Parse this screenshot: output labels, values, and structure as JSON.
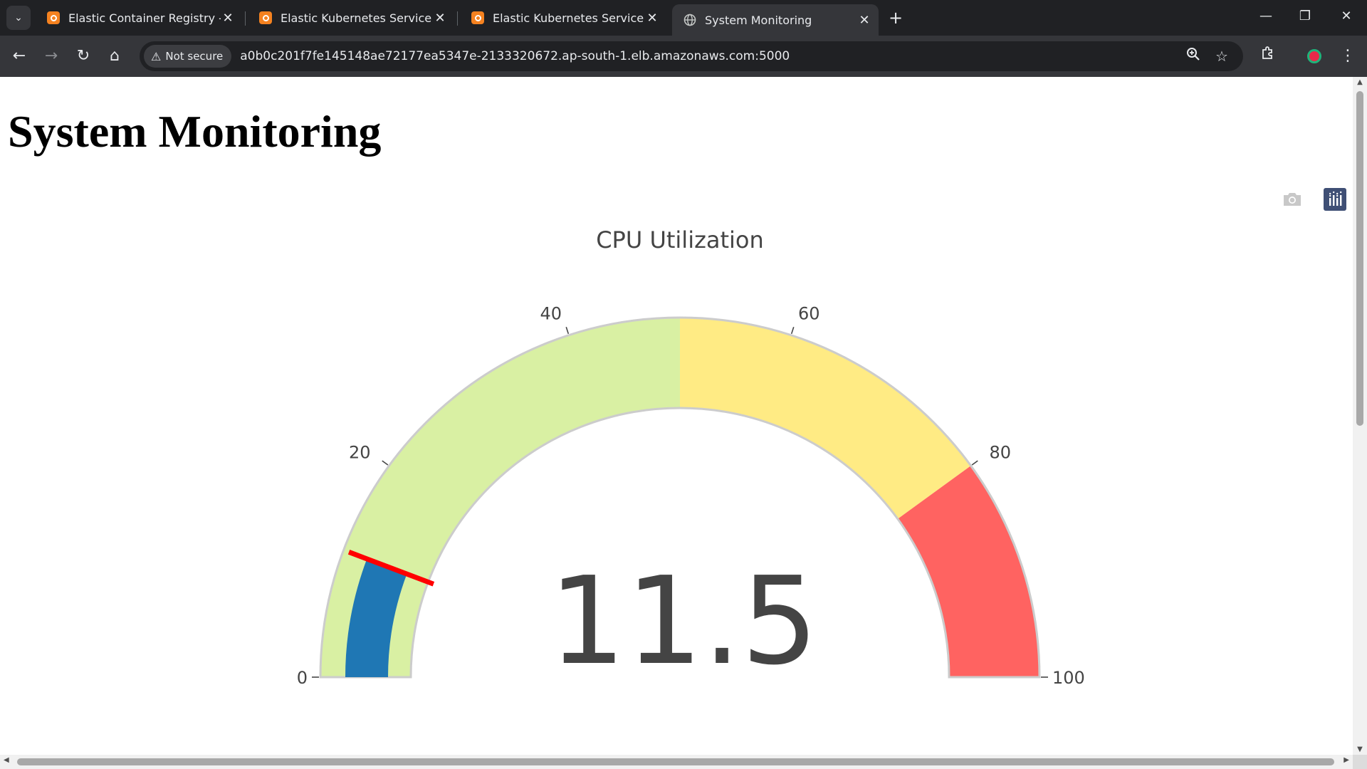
{
  "browser": {
    "tabs": [
      {
        "title": "Elastic Container Registry - Ima",
        "active": false,
        "icon": "aws-orange-icon"
      },
      {
        "title": "Elastic Kubernetes Service | ap-s",
        "active": false,
        "icon": "aws-orange-icon"
      },
      {
        "title": "Elastic Kubernetes Service | ap-s",
        "active": false,
        "icon": "aws-orange-icon"
      },
      {
        "title": "System Monitoring",
        "active": true,
        "icon": "globe-icon"
      }
    ],
    "security_label": "Not secure",
    "url": "a0b0c201f7fe145148ae72177ea5347e-2133320672.ap-south-1.elb.amazonaws.com:5000"
  },
  "page": {
    "heading": "System Monitoring"
  },
  "chart_data": {
    "type": "gauge",
    "title": "CPU Utilization",
    "value": 11.5,
    "value_text": "11.5",
    "range": [
      0,
      100
    ],
    "ticks": [
      0,
      20,
      40,
      60,
      80,
      100
    ],
    "bar_color": "#1f77b4",
    "threshold": 11.5,
    "threshold_color": "#ff0000",
    "steps": [
      {
        "range": [
          0,
          50
        ],
        "color": "#d9f0a3"
      },
      {
        "range": [
          50,
          80
        ],
        "color": "#ffeb84"
      },
      {
        "range": [
          80,
          100
        ],
        "color": "#ff6361"
      }
    ]
  }
}
